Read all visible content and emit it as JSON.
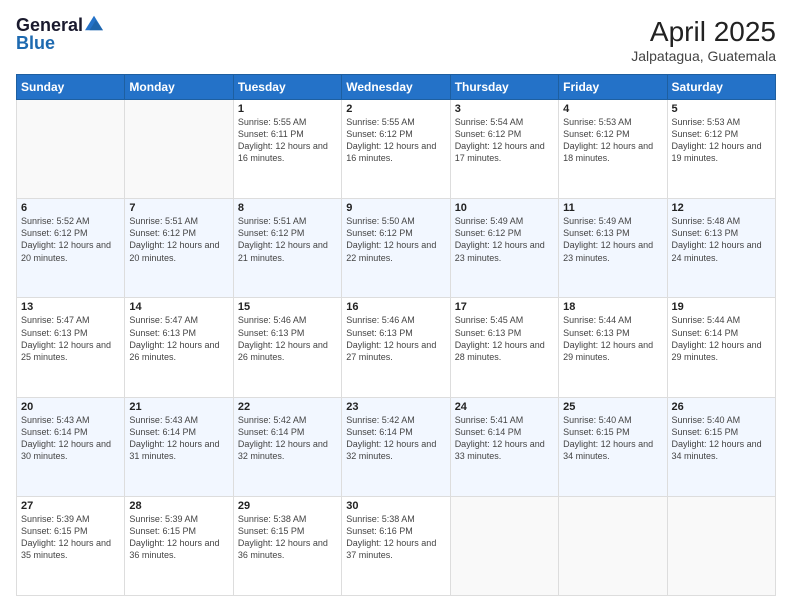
{
  "logo": {
    "general": "General",
    "blue": "Blue"
  },
  "header": {
    "title": "April 2025",
    "subtitle": "Jalpatagua, Guatemala"
  },
  "weekdays": [
    "Sunday",
    "Monday",
    "Tuesday",
    "Wednesday",
    "Thursday",
    "Friday",
    "Saturday"
  ],
  "weeks": [
    [
      {
        "day": "",
        "info": ""
      },
      {
        "day": "",
        "info": ""
      },
      {
        "day": "1",
        "info": "Sunrise: 5:55 AM\nSunset: 6:11 PM\nDaylight: 12 hours and 16 minutes."
      },
      {
        "day": "2",
        "info": "Sunrise: 5:55 AM\nSunset: 6:12 PM\nDaylight: 12 hours and 16 minutes."
      },
      {
        "day": "3",
        "info": "Sunrise: 5:54 AM\nSunset: 6:12 PM\nDaylight: 12 hours and 17 minutes."
      },
      {
        "day": "4",
        "info": "Sunrise: 5:53 AM\nSunset: 6:12 PM\nDaylight: 12 hours and 18 minutes."
      },
      {
        "day": "5",
        "info": "Sunrise: 5:53 AM\nSunset: 6:12 PM\nDaylight: 12 hours and 19 minutes."
      }
    ],
    [
      {
        "day": "6",
        "info": "Sunrise: 5:52 AM\nSunset: 6:12 PM\nDaylight: 12 hours and 20 minutes."
      },
      {
        "day": "7",
        "info": "Sunrise: 5:51 AM\nSunset: 6:12 PM\nDaylight: 12 hours and 20 minutes."
      },
      {
        "day": "8",
        "info": "Sunrise: 5:51 AM\nSunset: 6:12 PM\nDaylight: 12 hours and 21 minutes."
      },
      {
        "day": "9",
        "info": "Sunrise: 5:50 AM\nSunset: 6:12 PM\nDaylight: 12 hours and 22 minutes."
      },
      {
        "day": "10",
        "info": "Sunrise: 5:49 AM\nSunset: 6:12 PM\nDaylight: 12 hours and 23 minutes."
      },
      {
        "day": "11",
        "info": "Sunrise: 5:49 AM\nSunset: 6:13 PM\nDaylight: 12 hours and 23 minutes."
      },
      {
        "day": "12",
        "info": "Sunrise: 5:48 AM\nSunset: 6:13 PM\nDaylight: 12 hours and 24 minutes."
      }
    ],
    [
      {
        "day": "13",
        "info": "Sunrise: 5:47 AM\nSunset: 6:13 PM\nDaylight: 12 hours and 25 minutes."
      },
      {
        "day": "14",
        "info": "Sunrise: 5:47 AM\nSunset: 6:13 PM\nDaylight: 12 hours and 26 minutes."
      },
      {
        "day": "15",
        "info": "Sunrise: 5:46 AM\nSunset: 6:13 PM\nDaylight: 12 hours and 26 minutes."
      },
      {
        "day": "16",
        "info": "Sunrise: 5:46 AM\nSunset: 6:13 PM\nDaylight: 12 hours and 27 minutes."
      },
      {
        "day": "17",
        "info": "Sunrise: 5:45 AM\nSunset: 6:13 PM\nDaylight: 12 hours and 28 minutes."
      },
      {
        "day": "18",
        "info": "Sunrise: 5:44 AM\nSunset: 6:13 PM\nDaylight: 12 hours and 29 minutes."
      },
      {
        "day": "19",
        "info": "Sunrise: 5:44 AM\nSunset: 6:14 PM\nDaylight: 12 hours and 29 minutes."
      }
    ],
    [
      {
        "day": "20",
        "info": "Sunrise: 5:43 AM\nSunset: 6:14 PM\nDaylight: 12 hours and 30 minutes."
      },
      {
        "day": "21",
        "info": "Sunrise: 5:43 AM\nSunset: 6:14 PM\nDaylight: 12 hours and 31 minutes."
      },
      {
        "day": "22",
        "info": "Sunrise: 5:42 AM\nSunset: 6:14 PM\nDaylight: 12 hours and 32 minutes."
      },
      {
        "day": "23",
        "info": "Sunrise: 5:42 AM\nSunset: 6:14 PM\nDaylight: 12 hours and 32 minutes."
      },
      {
        "day": "24",
        "info": "Sunrise: 5:41 AM\nSunset: 6:14 PM\nDaylight: 12 hours and 33 minutes."
      },
      {
        "day": "25",
        "info": "Sunrise: 5:40 AM\nSunset: 6:15 PM\nDaylight: 12 hours and 34 minutes."
      },
      {
        "day": "26",
        "info": "Sunrise: 5:40 AM\nSunset: 6:15 PM\nDaylight: 12 hours and 34 minutes."
      }
    ],
    [
      {
        "day": "27",
        "info": "Sunrise: 5:39 AM\nSunset: 6:15 PM\nDaylight: 12 hours and 35 minutes."
      },
      {
        "day": "28",
        "info": "Sunrise: 5:39 AM\nSunset: 6:15 PM\nDaylight: 12 hours and 36 minutes."
      },
      {
        "day": "29",
        "info": "Sunrise: 5:38 AM\nSunset: 6:15 PM\nDaylight: 12 hours and 36 minutes."
      },
      {
        "day": "30",
        "info": "Sunrise: 5:38 AM\nSunset: 6:16 PM\nDaylight: 12 hours and 37 minutes."
      },
      {
        "day": "",
        "info": ""
      },
      {
        "day": "",
        "info": ""
      },
      {
        "day": "",
        "info": ""
      }
    ]
  ]
}
